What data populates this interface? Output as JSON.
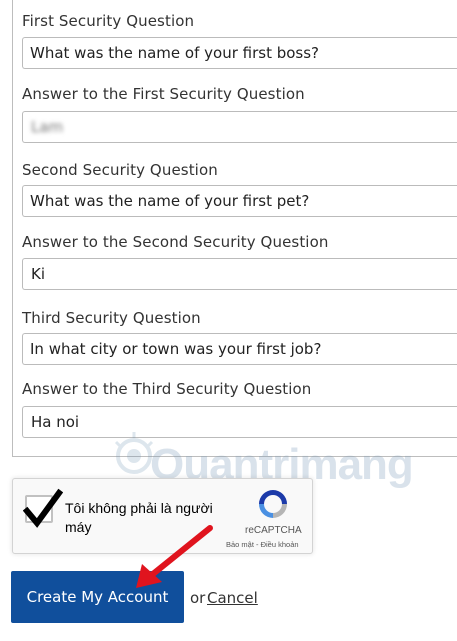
{
  "form": {
    "fields": [
      {
        "label": "First Security Question",
        "value": "What was the name of your first boss?"
      },
      {
        "label": "Answer to the First Security Question",
        "value": "Lam"
      },
      {
        "label": "Second Security Question",
        "value": "What was the name of your first pet?"
      },
      {
        "label": "Answer to the Second Security Question",
        "value": "Ki"
      },
      {
        "label": "Third Security Question",
        "value": "In what city or town was your first job?"
      },
      {
        "label": "Answer to the Third Security Question",
        "value": "Ha noi"
      }
    ]
  },
  "recaptcha": {
    "label": "Tôi không phải là người máy",
    "brand": "reCAPTCHA",
    "links": "Bảo mật - Điều khoản",
    "checked": true
  },
  "actions": {
    "create_label": "Create My Account",
    "or_text": "or",
    "cancel_label": "Cancel"
  },
  "watermark": {
    "text": "Quantrimang"
  },
  "colors": {
    "primary_button": "#104f9c",
    "arrow": "#e0141e"
  }
}
